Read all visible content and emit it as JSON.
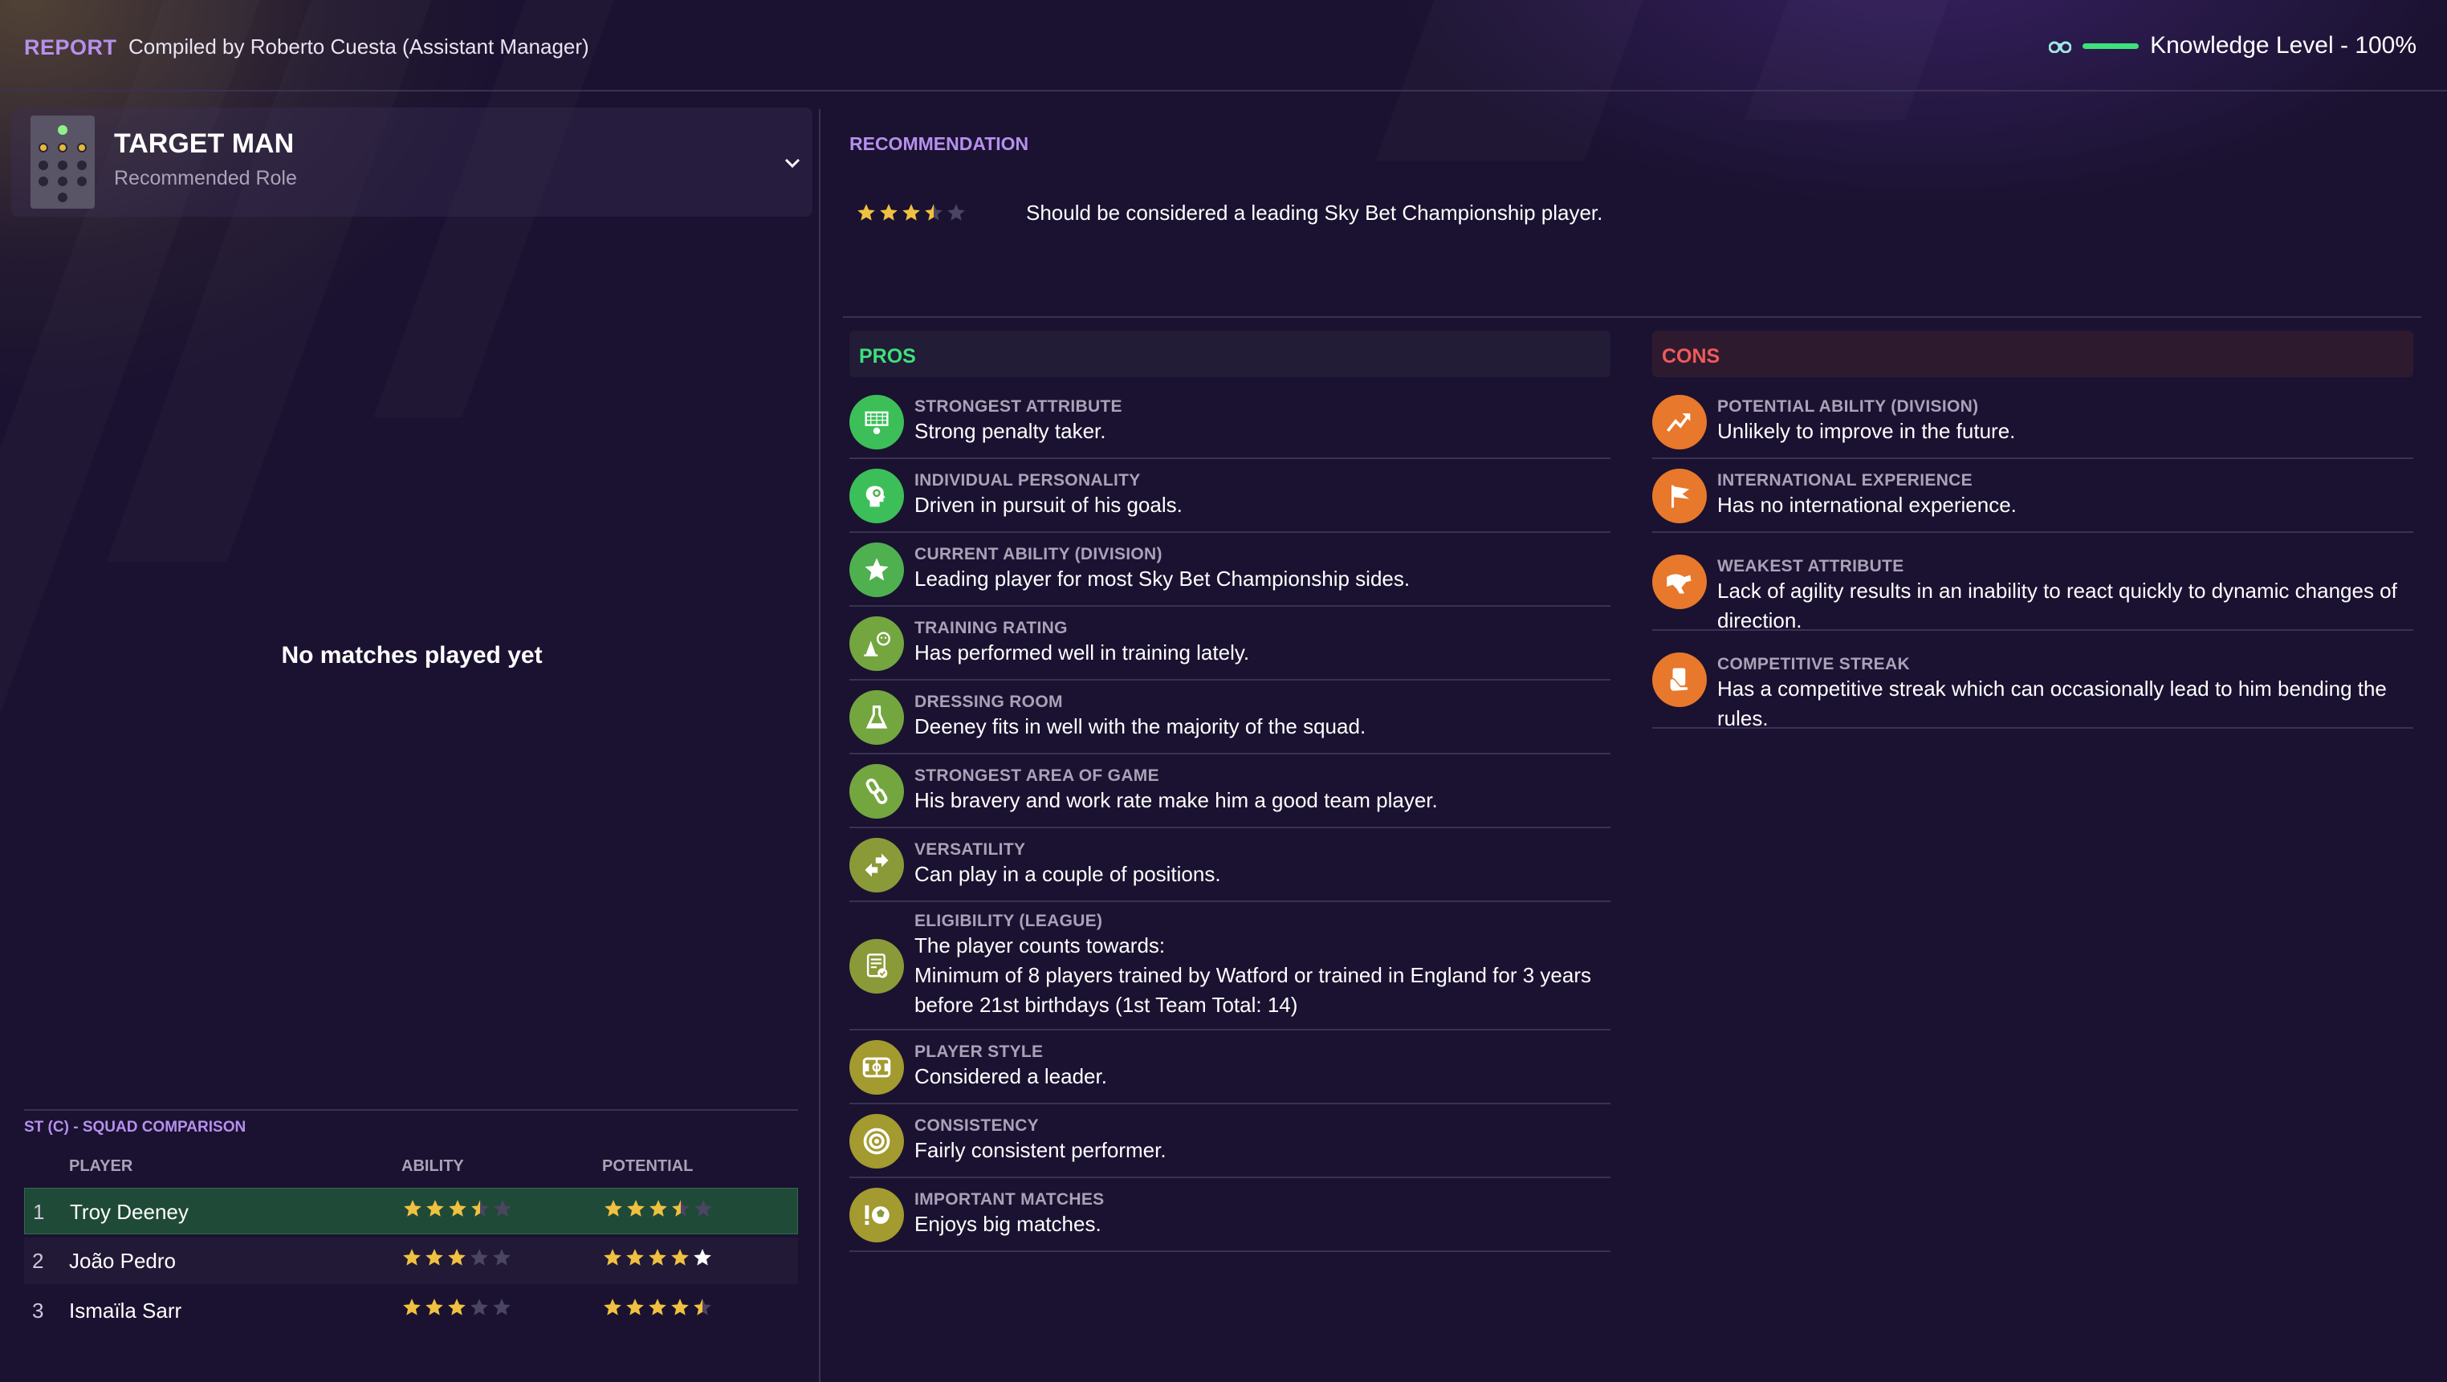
{
  "header": {
    "report_label": "REPORT",
    "compiled_by": "Compiled by Roberto Cuesta (Assistant Manager)",
    "knowledge_level": "Knowledge Level - 100%",
    "knowledge_fraction": 1.0,
    "accent_color": "#b690ee"
  },
  "role": {
    "title": "TARGET MAN",
    "subtitle": "Recommended Role",
    "icon": "formation-pitch-icon"
  },
  "matches": {
    "empty_text": "No matches played yet"
  },
  "squad_comparison": {
    "title": "ST (C) - SQUAD COMPARISON",
    "columns": [
      "PLAYER",
      "ABILITY",
      "POTENTIAL"
    ],
    "rows": [
      {
        "rank": "1",
        "name": "Troy Deeney",
        "ability_stars": 3.5,
        "potential_stars": 3.5,
        "highlighted": true
      },
      {
        "rank": "2",
        "name": "João Pedro",
        "ability_stars": 3,
        "potential_stars": 5,
        "highlighted": false
      },
      {
        "rank": "3",
        "name": "Ismaïla Sarr",
        "ability_stars": 3,
        "potential_stars": 4.5,
        "highlighted": false
      }
    ]
  },
  "recommendation": {
    "title": "RECOMMENDATION",
    "stars": 3.5,
    "text": "Should be considered a leading Sky Bet Championship player."
  },
  "pros": {
    "title": "PROS",
    "color": "#3de07a",
    "items": [
      {
        "label": "STRONGEST ATTRIBUTE",
        "text": "Strong penalty taker.",
        "icon": "penalty-goal-icon"
      },
      {
        "label": "INDIVIDUAL PERSONALITY",
        "text": "Driven in pursuit of his goals.",
        "icon": "head-profile-icon"
      },
      {
        "label": "CURRENT ABILITY (DIVISION)",
        "text": "Leading player for most Sky Bet Championship sides.",
        "icon": "star-icon"
      },
      {
        "label": "TRAINING RATING",
        "text": "Has performed well in training lately.",
        "icon": "training-cone-icon"
      },
      {
        "label": "DRESSING ROOM",
        "text": "Deeney fits in well with the majority of the squad.",
        "icon": "flask-icon"
      },
      {
        "label": "STRONGEST AREA OF GAME",
        "text": "His bravery and work rate make him a good team player.",
        "icon": "chain-link-icon"
      },
      {
        "label": "VERSATILITY",
        "text": "Can play in a couple of positions.",
        "icon": "swap-arrows-icon"
      },
      {
        "label": "ELIGIBILITY (LEAGUE)",
        "text": "The player counts towards:\nMinimum of 8 players trained by Watford or trained in England for 3 years before 21st birthdays (1st Team Total: 14)",
        "icon": "document-check-icon"
      },
      {
        "label": "PLAYER STYLE",
        "text": "Considered a leader.",
        "icon": "pitch-icon"
      },
      {
        "label": "CONSISTENCY",
        "text": "Fairly consistent performer.",
        "icon": "target-icon"
      },
      {
        "label": "IMPORTANT MATCHES",
        "text": "Enjoys big matches.",
        "icon": "ball-exclaim-icon"
      }
    ]
  },
  "cons": {
    "title": "CONS",
    "color": "#f05a5a",
    "items": [
      {
        "label": "POTENTIAL ABILITY (DIVISION)",
        "text": "Unlikely to improve in the future.",
        "icon": "trend-up-icon"
      },
      {
        "label": "INTERNATIONAL EXPERIENCE",
        "text": "Has no international experience.",
        "icon": "flag-icon"
      },
      {
        "label": "WEAKEST ATTRIBUTE",
        "text": "Lack of agility results in an inability to react quickly to dynamic changes of direction.",
        "icon": "running-player-icon"
      },
      {
        "label": "COMPETITIVE STREAK",
        "text": "Has a competitive streak which can occasionally lead to him bending the rules.",
        "icon": "card-hand-icon"
      }
    ]
  }
}
